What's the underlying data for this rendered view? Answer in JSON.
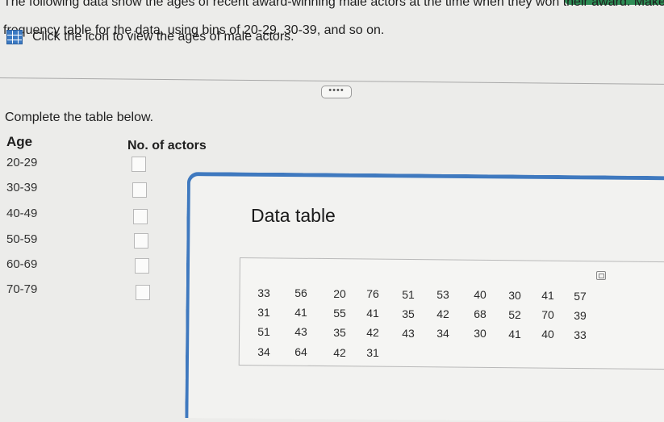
{
  "header": {
    "line1": "The following data show the ages of recent award-winning male actors at the time when they won their award. Make a",
    "line2": "frequency table for the data, using bins of 20-29, 30-39, and so on.",
    "instruction": "Click the icon to view the ages of male actors."
  },
  "expand_label": "••••",
  "form": {
    "prompt": "Complete the table below.",
    "age_header": "Age",
    "actors_header": "No. of actors",
    "rows": [
      {
        "age": "20-29",
        "count": ""
      },
      {
        "age": "30-39",
        "count": ""
      },
      {
        "age": "40-49",
        "count": ""
      },
      {
        "age": "50-59",
        "count": ""
      },
      {
        "age": "60-69",
        "count": ""
      },
      {
        "age": "70-79",
        "count": ""
      }
    ]
  },
  "data_table": {
    "title": "Data table",
    "columns": [
      [
        "33",
        "31",
        "51",
        "34"
      ],
      [
        "56",
        "41",
        "43",
        "64"
      ],
      [
        "20",
        "55",
        "35",
        "42"
      ],
      [
        "76",
        "41",
        "42",
        "31"
      ],
      [
        "51",
        "35",
        "43"
      ],
      [
        "53",
        "42",
        "34"
      ],
      [
        "40",
        "68",
        "30"
      ],
      [
        "30",
        "52",
        "41"
      ],
      [
        "41",
        "70",
        "40"
      ],
      [
        "57",
        "39",
        "33"
      ]
    ]
  },
  "colors": {
    "accent_blue": "#3f79bf",
    "top_accent_green": "#2e8c55"
  }
}
